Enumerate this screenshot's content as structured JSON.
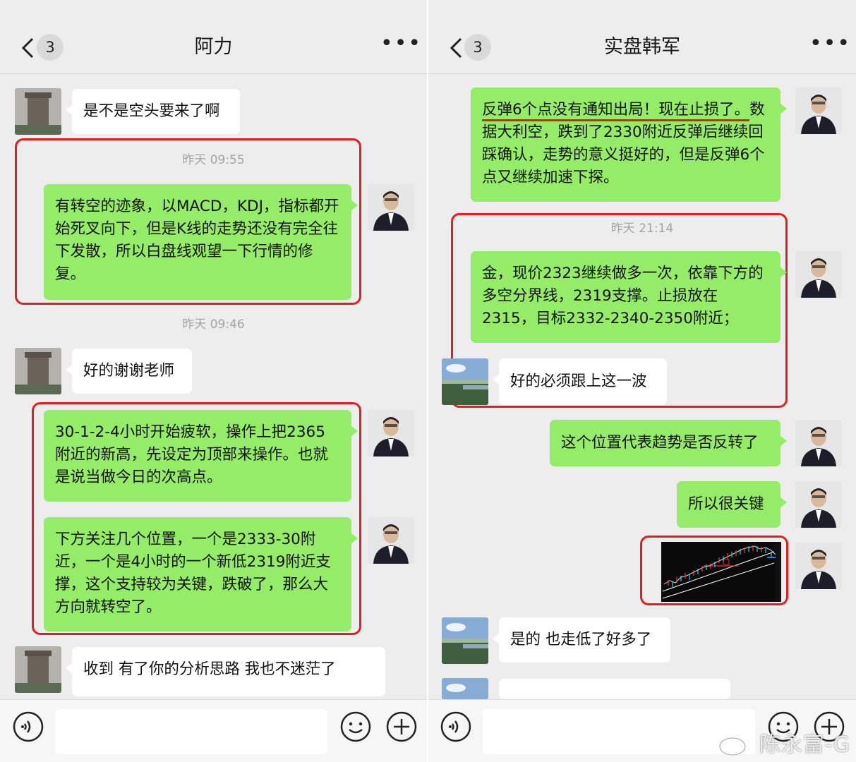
{
  "left_chat": {
    "title": "阿力",
    "unread_count": "3",
    "messages": [
      "是不是空头要来了啊",
      "有转空的迹象，以MACD，KDJ，指标都开始死叉向下，但是K线的走势还没有完全往下发散，所以白盘线观望一下行情的修复。",
      "好的谢谢老师",
      "30-1-2-4小时开始疲软，操作上把2365附近的新高，先设定为顶部来操作。也就是说当做今日的次高点。",
      "下方关注几个位置，一个是2333-30附近，一个是4小时的一个新低2319附近支撑，这个支持较为关键，跌破了，那么大方向就转空了。",
      "收到 有了你的分析思路 我也不迷茫了"
    ],
    "timestamps": [
      "昨天 09:55",
      "昨天 09:46"
    ]
  },
  "right_chat": {
    "title": "实盘韩军",
    "unread_count": "3",
    "messages": [
      "反弹6个点没有通知出局！现在止损了。",
      "数据大利空，跌到了2330附近反弹后继续回踩确认，走势的意义挺好的，但是反弹6个点又继续加速下探。",
      "金，现价2323继续做多一次，依靠下方的多空分界线，2319支撑。止损放在2315，目标2332-2340-2350附近；",
      "好的必须跟上这一波",
      "这个位置代表趋势是否反转了",
      "所以很关键",
      "是的 也走低了好多了"
    ],
    "timestamps": [
      "昨天 21:14"
    ]
  },
  "watermark": "陈永富-G",
  "icons": [
    "back-chevron-icon",
    "more-dots-icon",
    "voice-icon",
    "emoji-icon",
    "plus-icon"
  ],
  "colors": {
    "bubble_green": "#95ec69",
    "highlight_red": "#e02020",
    "background": "#ededed"
  }
}
